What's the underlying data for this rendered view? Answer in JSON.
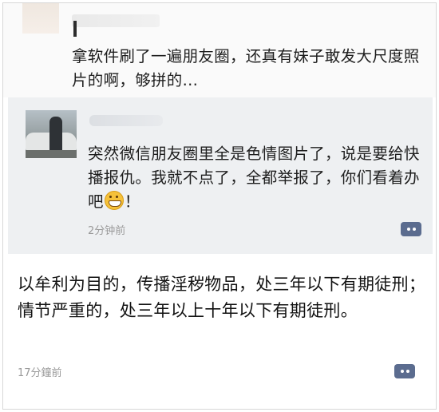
{
  "post1": {
    "text": "拿软件刷了一遍朋友圈，还真有妹子敢发大尺度照片的啊，够拼的..."
  },
  "post2": {
    "text_before_emoji": "突然微信朋友圈里全是色情图片了，说是要给快播报仇。我就不点了，全都举报了，你们看着办吧",
    "text_after_emoji": "！",
    "time": "2分钟前",
    "emoji_icon": "grin-emoji",
    "comment_icon": "comment-icon"
  },
  "post3": {
    "text": "以牟利为目的，传播淫秽物品，处三年以下有期徒刑；情节严重的，处三年以上十年以下有期徒刑。",
    "time": "17分鐘前",
    "comment_icon": "comment-icon"
  },
  "colors": {
    "comment_button": "#5b6c8f",
    "card_background": "#eef0f2",
    "timestamp": "#9a9a9a"
  }
}
